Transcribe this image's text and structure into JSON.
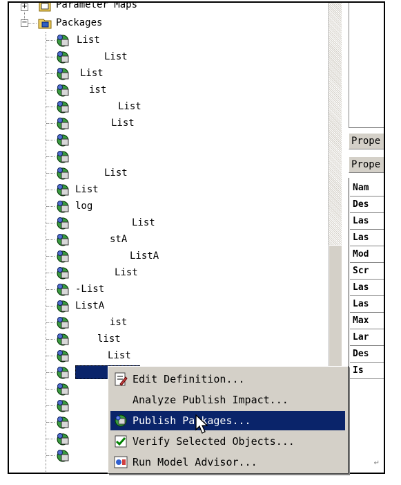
{
  "tree": {
    "top_item_label": "Parameter Maps",
    "packages_label": "Packages",
    "items": [
      "List",
      "List",
      "List",
      "ist",
      "List",
      "List",
      "",
      "",
      "List",
      "List",
      "log",
      "List",
      "stA",
      "ListA",
      "List",
      "-List",
      "ListA",
      "ist",
      "list",
      "List",
      "",
      "",
      "",
      "",
      "",
      ""
    ]
  },
  "right_pane": {
    "tab1": "Prope",
    "tab2": "Prope",
    "props": [
      "Nam",
      "Des",
      "Las",
      "Las",
      "Mod",
      "Scr",
      "Las",
      "Las",
      "Max",
      "Lar",
      "Des",
      "Is"
    ]
  },
  "context_menu": {
    "items": [
      {
        "label": "Edit Definition...",
        "icon": "edit-definition-icon"
      },
      {
        "label": "Analyze Publish Impact...",
        "icon": ""
      },
      {
        "label": "Publish Packages...",
        "icon": "publish-packages-icon"
      },
      {
        "label": "Verify Selected Objects...",
        "icon": "verify-objects-icon"
      },
      {
        "label": "Run Model Advisor...",
        "icon": "model-advisor-icon"
      }
    ],
    "highlighted_index": 2
  },
  "colors": {
    "selection": "#0a246a",
    "menu_bg": "#d4d0c8"
  }
}
